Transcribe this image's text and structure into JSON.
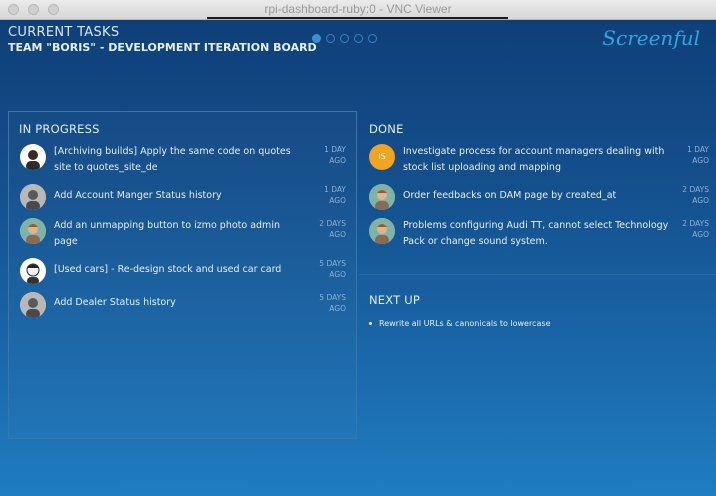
{
  "window": {
    "title": "rpi-dashboard-ruby:0 - VNC Viewer"
  },
  "header": {
    "title": "CURRENT TASKS",
    "subtitle": "TEAM \"BORIS\" - DEVELOPMENT ITERATION BOARD",
    "logo": "Screenful"
  },
  "in_progress": {
    "title": "IN PROGRESS",
    "tasks": [
      {
        "text": "[Archiving builds] Apply the same code on quotes site to quotes_site_de",
        "ago1": "1 DAY",
        "ago2": "AGO"
      },
      {
        "text": "Add Account Manger Status history",
        "ago1": "1 DAY",
        "ago2": "AGO"
      },
      {
        "text": "Add an unmapping button to izmo photo admin page",
        "ago1": "2 DAYS",
        "ago2": "AGO"
      },
      {
        "text": "[Used cars] - Re-design stock and used car card",
        "ago1": "5 DAYS",
        "ago2": "AGO"
      },
      {
        "text": "Add Dealer Status history",
        "ago1": "5 DAYS",
        "ago2": "AGO"
      }
    ]
  },
  "done": {
    "title": "DONE",
    "tasks": [
      {
        "initials": "IS",
        "text": "Investigate process for account managers dealing with stock list uploading and mapping",
        "ago1": "1 DAY",
        "ago2": "AGO"
      },
      {
        "text": "Order feedbacks on DAM page by created_at",
        "ago1": "2 DAYS",
        "ago2": "AGO"
      },
      {
        "text": "Problems configuring Audi TT, cannot select Technology Pack or change sound system.",
        "ago1": "2 DAYS",
        "ago2": "AGO"
      }
    ]
  },
  "next_up": {
    "title": "NEXT UP",
    "items": [
      "Rewrite all URLs & canonicals to lowercase"
    ]
  },
  "colors": {
    "background_top": "#0f3f78",
    "background_bottom": "#1f7dc0",
    "logo": "#2fa6e0",
    "initials_avatar": "#f0a420"
  }
}
